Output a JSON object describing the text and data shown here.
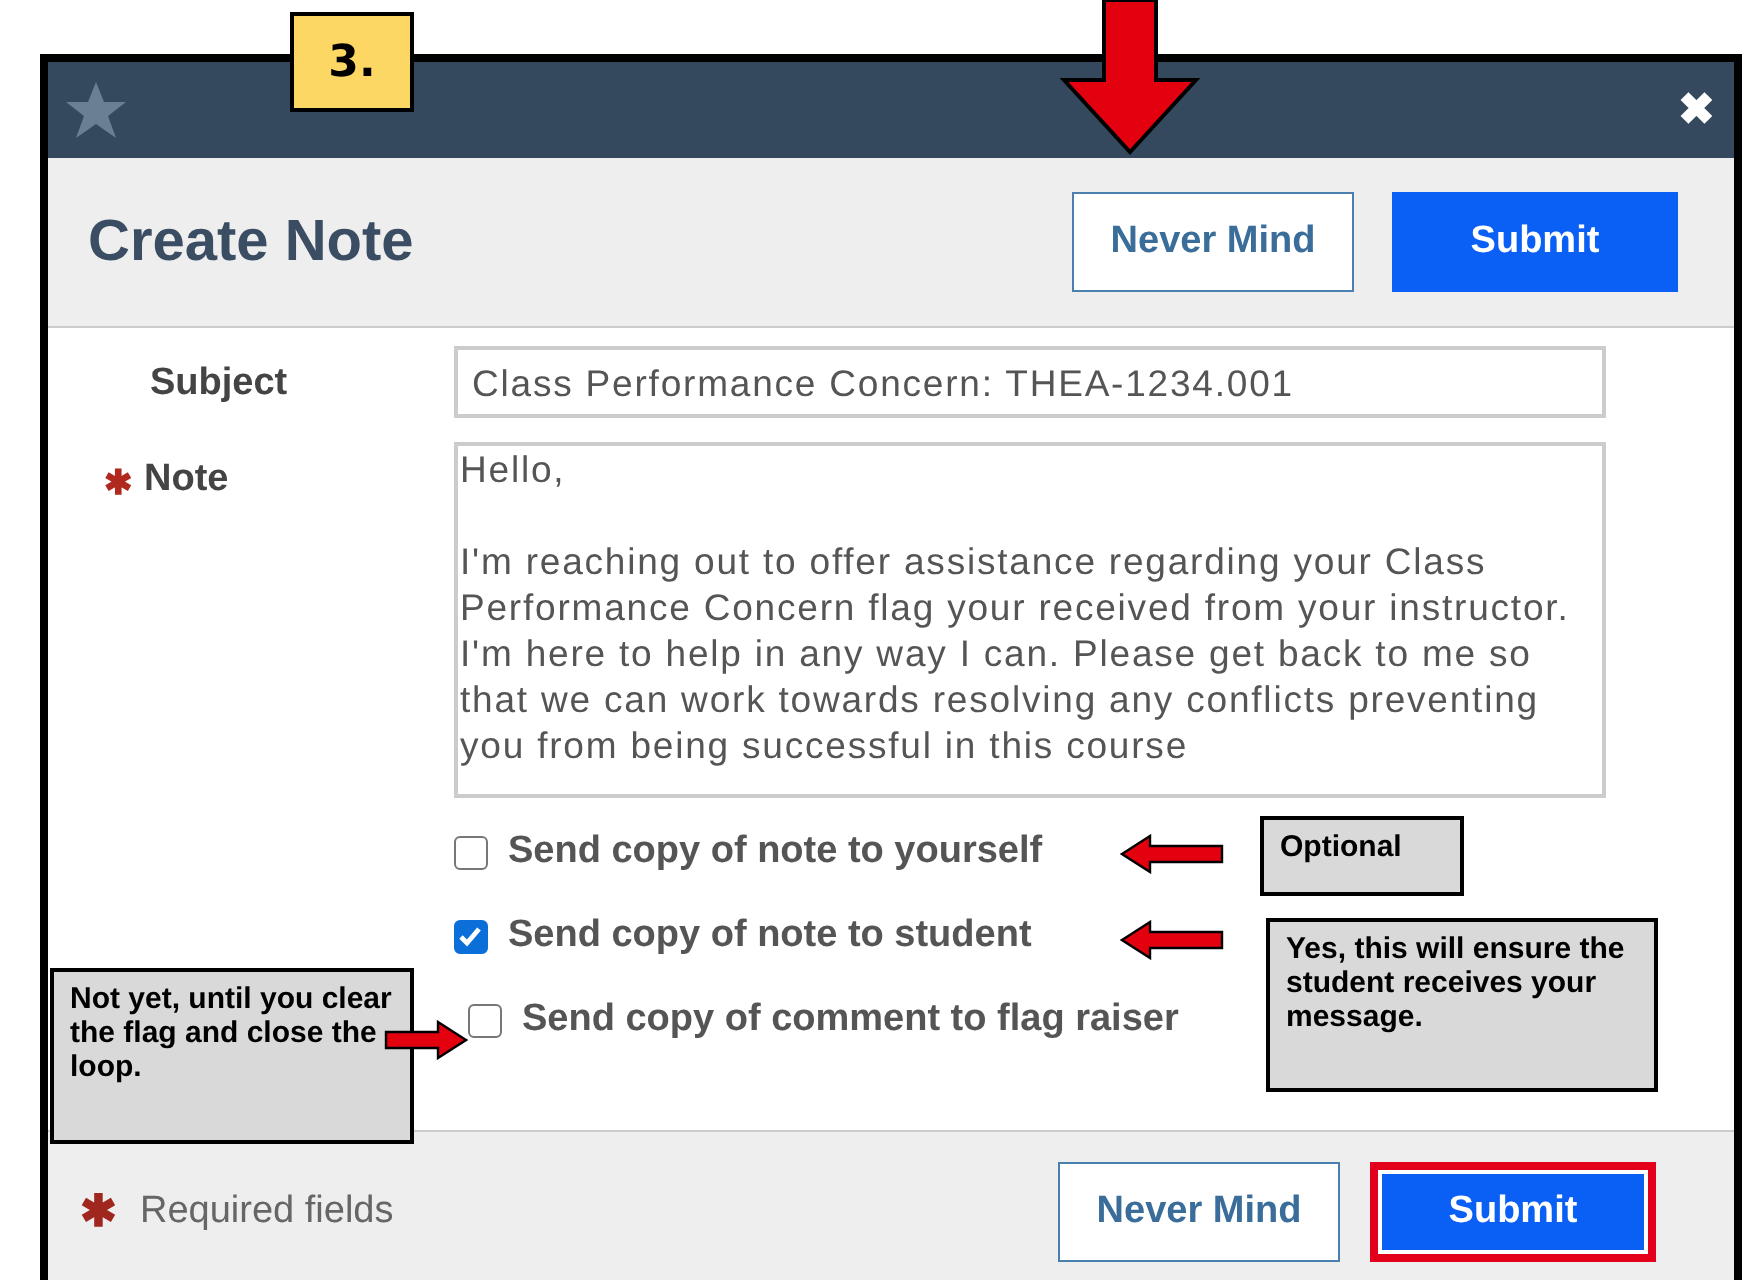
{
  "dialog": {
    "title": "Create Note",
    "close": "✖",
    "header_buttons": [
      {
        "label": "Never Mind",
        "kind": "secondary",
        "highlighted": false
      },
      {
        "label": "Submit",
        "kind": "primary",
        "highlighted": false
      }
    ],
    "fields": [
      {
        "label": "Subject",
        "required": false,
        "kind": "input",
        "value": "Class Performance Concern: THEA-1234.001"
      },
      {
        "label": "Note",
        "required": true,
        "kind": "textarea",
        "value": "Hello,\n\nI'm reaching out to offer assistance regarding your Class Performance Concern flag your received from your instructor. I'm here to help in any way I can. Please get back to me so that we can work towards resolving any conflicts preventing you from being successful in this course"
      }
    ],
    "checkboxes": [
      {
        "label": "Send copy of note to yourself",
        "checked": false
      },
      {
        "label": "Send copy of note to student",
        "checked": true
      },
      {
        "label": "Send copy of comment to flag raiser",
        "checked": false
      }
    ],
    "footer": {
      "required_mark": "✱",
      "required_text": "Required fields",
      "buttons": [
        {
          "label": "Never Mind",
          "kind": "secondary",
          "highlighted": false
        },
        {
          "label": "Submit",
          "kind": "primary",
          "highlighted": true
        }
      ]
    }
  },
  "annotations": [
    {
      "kind": "badge",
      "text": "3."
    },
    {
      "kind": "down_arrow"
    },
    {
      "kind": "left_arrow"
    },
    {
      "kind": "callout",
      "text": "Optional"
    },
    {
      "kind": "left_arrow"
    },
    {
      "kind": "callout",
      "text": "Yes, this will ensure the student receives your message."
    },
    {
      "kind": "callout",
      "text": "Not yet, until you clear the flag and close the loop."
    },
    {
      "kind": "right_arrow"
    }
  ]
}
